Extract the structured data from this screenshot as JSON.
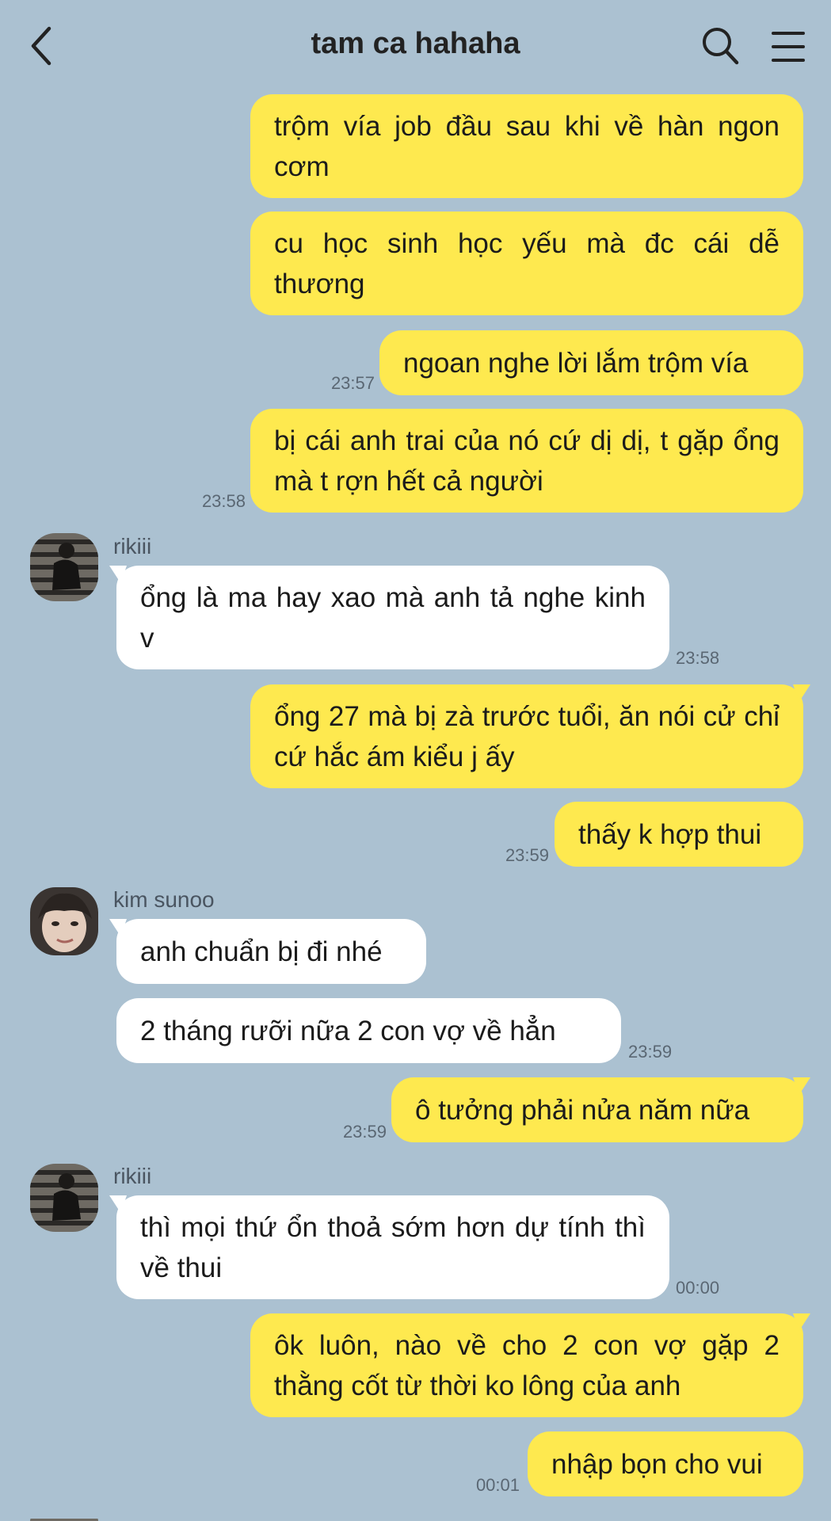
{
  "header": {
    "title": "tam ca hahaha",
    "back_icon": "chevron-left-icon",
    "search_icon": "search-icon",
    "menu_icon": "hamburger-menu-icon"
  },
  "colors": {
    "background": "#abc1d1",
    "my_bubble": "#fee94f",
    "their_bubble": "#ffffff"
  },
  "messages": [
    {
      "sender": "me",
      "text": "trộm vía job đầu sau khi về hàn ngon cơm",
      "time": ""
    },
    {
      "sender": "me",
      "text": "cu học sinh học yếu mà đc cái dễ thương",
      "time": ""
    },
    {
      "sender": "me",
      "text": "ngoan nghe lời lắm trộm vía",
      "time": "23:57"
    },
    {
      "sender": "me",
      "text": "bị cái anh trai của nó cứ dị dị, t gặp ổng mà t rợn hết cả người",
      "time": "23:58"
    },
    {
      "sender": "rikiii",
      "name": "rikiii",
      "text": "ổng là ma hay xao mà anh tả nghe kinh v",
      "time": "23:58"
    },
    {
      "sender": "me",
      "text": "ổng 27 mà bị zà trước tuổi, ăn nói cử chỉ cứ hắc ám kiểu j ấy",
      "time": ""
    },
    {
      "sender": "me",
      "text": "thấy k hợp thui",
      "time": "23:59"
    },
    {
      "sender": "kim sunoo",
      "name": "kim sunoo",
      "text": "anh chuẩn bị đi nhé",
      "time": ""
    },
    {
      "sender": "kim sunoo",
      "text": "2 tháng rưỡi nữa 2 con vợ về hẳn",
      "time": "23:59"
    },
    {
      "sender": "me",
      "text": "ô tưởng phải nửa năm nữa",
      "time": "23:59"
    },
    {
      "sender": "rikiii",
      "name": "rikiii",
      "text": "thì mọi thứ ổn thoả sớm hơn dự tính thì về thui",
      "time": "00:00"
    },
    {
      "sender": "me",
      "text": "ôk luôn, nào về cho 2 con vợ gặp 2 thằng cốt từ thời ko lông của anh",
      "time": ""
    },
    {
      "sender": "me",
      "text": "nhập bọn cho vui",
      "time": "00:01"
    }
  ]
}
